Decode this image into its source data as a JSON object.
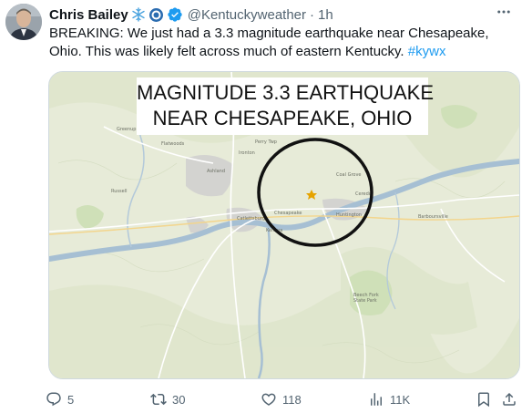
{
  "author": {
    "name": "Chris Bailey",
    "handle": "@Kentuckyweather",
    "separator": "·",
    "time": "1h",
    "icons": [
      "snowflake-icon",
      "badge-icon",
      "verified-icon"
    ]
  },
  "tweet": {
    "text": "BREAKING: We just had a 3.3 magnitude earthquake near Chesapeake, Ohio. This was likely felt across much of eastern Kentucky.",
    "hashtag": "#kywx"
  },
  "media": {
    "title_line1": "MAGNITUDE 3.3 EARTHQUAKE",
    "title_line2": "NEAR CHESAPEAKE, OHIO",
    "map_labels": [
      "Perry Twp",
      "Flatwoods",
      "Greenup",
      "Ironton",
      "Coal Grove",
      "Ashland",
      "Chesapeake",
      "Huntington",
      "Russell",
      "Catlettsburg",
      "Kenova",
      "Ceredo",
      "Barboursville",
      "Beech Fork State Park"
    ]
  },
  "actions": {
    "replies": "5",
    "reposts": "30",
    "likes": "118",
    "views": "11K"
  },
  "colors": {
    "link": "#1d9bf0",
    "muted": "#536471",
    "verified": "#1d9bf0",
    "map_land": "#e7ebd8",
    "river": "#a6bfd3"
  }
}
